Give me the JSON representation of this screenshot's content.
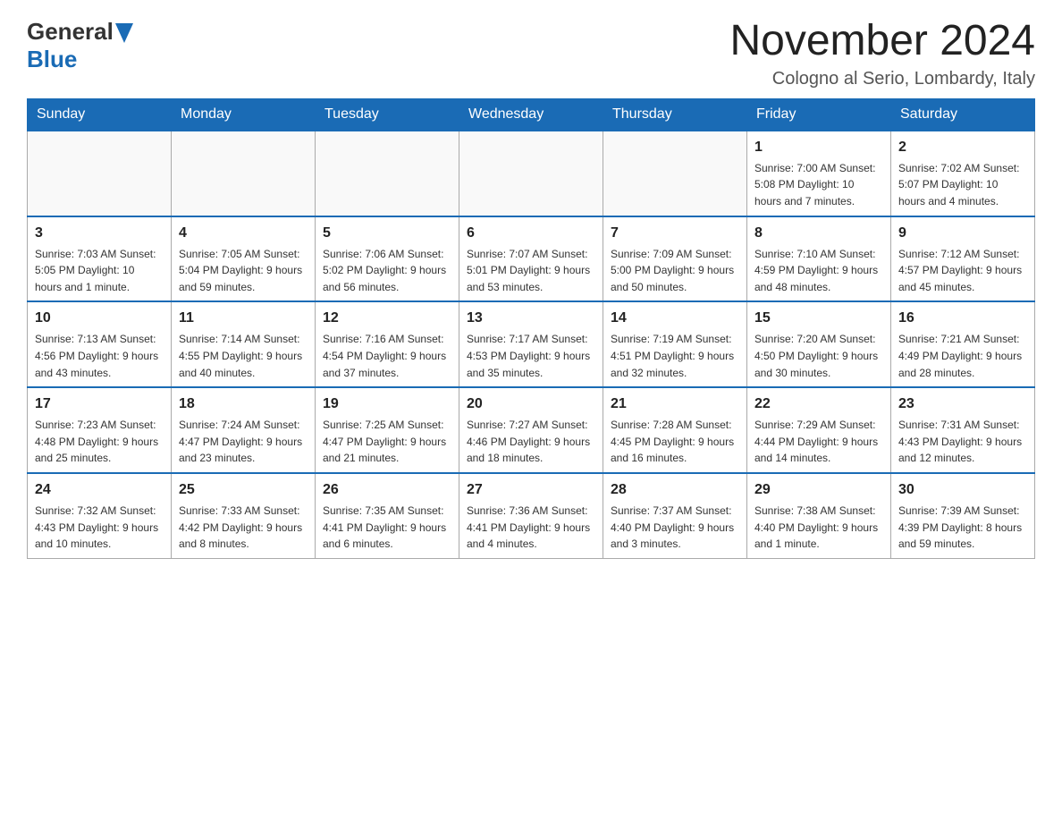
{
  "header": {
    "logo_line1": "General",
    "logo_line2": "Blue",
    "month_title": "November 2024",
    "location": "Cologno al Serio, Lombardy, Italy"
  },
  "days_of_week": [
    "Sunday",
    "Monday",
    "Tuesday",
    "Wednesday",
    "Thursday",
    "Friday",
    "Saturday"
  ],
  "weeks": [
    {
      "days": [
        {
          "num": "",
          "info": ""
        },
        {
          "num": "",
          "info": ""
        },
        {
          "num": "",
          "info": ""
        },
        {
          "num": "",
          "info": ""
        },
        {
          "num": "",
          "info": ""
        },
        {
          "num": "1",
          "info": "Sunrise: 7:00 AM\nSunset: 5:08 PM\nDaylight: 10 hours\nand 7 minutes."
        },
        {
          "num": "2",
          "info": "Sunrise: 7:02 AM\nSunset: 5:07 PM\nDaylight: 10 hours\nand 4 minutes."
        }
      ]
    },
    {
      "days": [
        {
          "num": "3",
          "info": "Sunrise: 7:03 AM\nSunset: 5:05 PM\nDaylight: 10 hours\nand 1 minute."
        },
        {
          "num": "4",
          "info": "Sunrise: 7:05 AM\nSunset: 5:04 PM\nDaylight: 9 hours\nand 59 minutes."
        },
        {
          "num": "5",
          "info": "Sunrise: 7:06 AM\nSunset: 5:02 PM\nDaylight: 9 hours\nand 56 minutes."
        },
        {
          "num": "6",
          "info": "Sunrise: 7:07 AM\nSunset: 5:01 PM\nDaylight: 9 hours\nand 53 minutes."
        },
        {
          "num": "7",
          "info": "Sunrise: 7:09 AM\nSunset: 5:00 PM\nDaylight: 9 hours\nand 50 minutes."
        },
        {
          "num": "8",
          "info": "Sunrise: 7:10 AM\nSunset: 4:59 PM\nDaylight: 9 hours\nand 48 minutes."
        },
        {
          "num": "9",
          "info": "Sunrise: 7:12 AM\nSunset: 4:57 PM\nDaylight: 9 hours\nand 45 minutes."
        }
      ]
    },
    {
      "days": [
        {
          "num": "10",
          "info": "Sunrise: 7:13 AM\nSunset: 4:56 PM\nDaylight: 9 hours\nand 43 minutes."
        },
        {
          "num": "11",
          "info": "Sunrise: 7:14 AM\nSunset: 4:55 PM\nDaylight: 9 hours\nand 40 minutes."
        },
        {
          "num": "12",
          "info": "Sunrise: 7:16 AM\nSunset: 4:54 PM\nDaylight: 9 hours\nand 37 minutes."
        },
        {
          "num": "13",
          "info": "Sunrise: 7:17 AM\nSunset: 4:53 PM\nDaylight: 9 hours\nand 35 minutes."
        },
        {
          "num": "14",
          "info": "Sunrise: 7:19 AM\nSunset: 4:51 PM\nDaylight: 9 hours\nand 32 minutes."
        },
        {
          "num": "15",
          "info": "Sunrise: 7:20 AM\nSunset: 4:50 PM\nDaylight: 9 hours\nand 30 minutes."
        },
        {
          "num": "16",
          "info": "Sunrise: 7:21 AM\nSunset: 4:49 PM\nDaylight: 9 hours\nand 28 minutes."
        }
      ]
    },
    {
      "days": [
        {
          "num": "17",
          "info": "Sunrise: 7:23 AM\nSunset: 4:48 PM\nDaylight: 9 hours\nand 25 minutes."
        },
        {
          "num": "18",
          "info": "Sunrise: 7:24 AM\nSunset: 4:47 PM\nDaylight: 9 hours\nand 23 minutes."
        },
        {
          "num": "19",
          "info": "Sunrise: 7:25 AM\nSunset: 4:47 PM\nDaylight: 9 hours\nand 21 minutes."
        },
        {
          "num": "20",
          "info": "Sunrise: 7:27 AM\nSunset: 4:46 PM\nDaylight: 9 hours\nand 18 minutes."
        },
        {
          "num": "21",
          "info": "Sunrise: 7:28 AM\nSunset: 4:45 PM\nDaylight: 9 hours\nand 16 minutes."
        },
        {
          "num": "22",
          "info": "Sunrise: 7:29 AM\nSunset: 4:44 PM\nDaylight: 9 hours\nand 14 minutes."
        },
        {
          "num": "23",
          "info": "Sunrise: 7:31 AM\nSunset: 4:43 PM\nDaylight: 9 hours\nand 12 minutes."
        }
      ]
    },
    {
      "days": [
        {
          "num": "24",
          "info": "Sunrise: 7:32 AM\nSunset: 4:43 PM\nDaylight: 9 hours\nand 10 minutes."
        },
        {
          "num": "25",
          "info": "Sunrise: 7:33 AM\nSunset: 4:42 PM\nDaylight: 9 hours\nand 8 minutes."
        },
        {
          "num": "26",
          "info": "Sunrise: 7:35 AM\nSunset: 4:41 PM\nDaylight: 9 hours\nand 6 minutes."
        },
        {
          "num": "27",
          "info": "Sunrise: 7:36 AM\nSunset: 4:41 PM\nDaylight: 9 hours\nand 4 minutes."
        },
        {
          "num": "28",
          "info": "Sunrise: 7:37 AM\nSunset: 4:40 PM\nDaylight: 9 hours\nand 3 minutes."
        },
        {
          "num": "29",
          "info": "Sunrise: 7:38 AM\nSunset: 4:40 PM\nDaylight: 9 hours\nand 1 minute."
        },
        {
          "num": "30",
          "info": "Sunrise: 7:39 AM\nSunset: 4:39 PM\nDaylight: 8 hours\nand 59 minutes."
        }
      ]
    }
  ]
}
